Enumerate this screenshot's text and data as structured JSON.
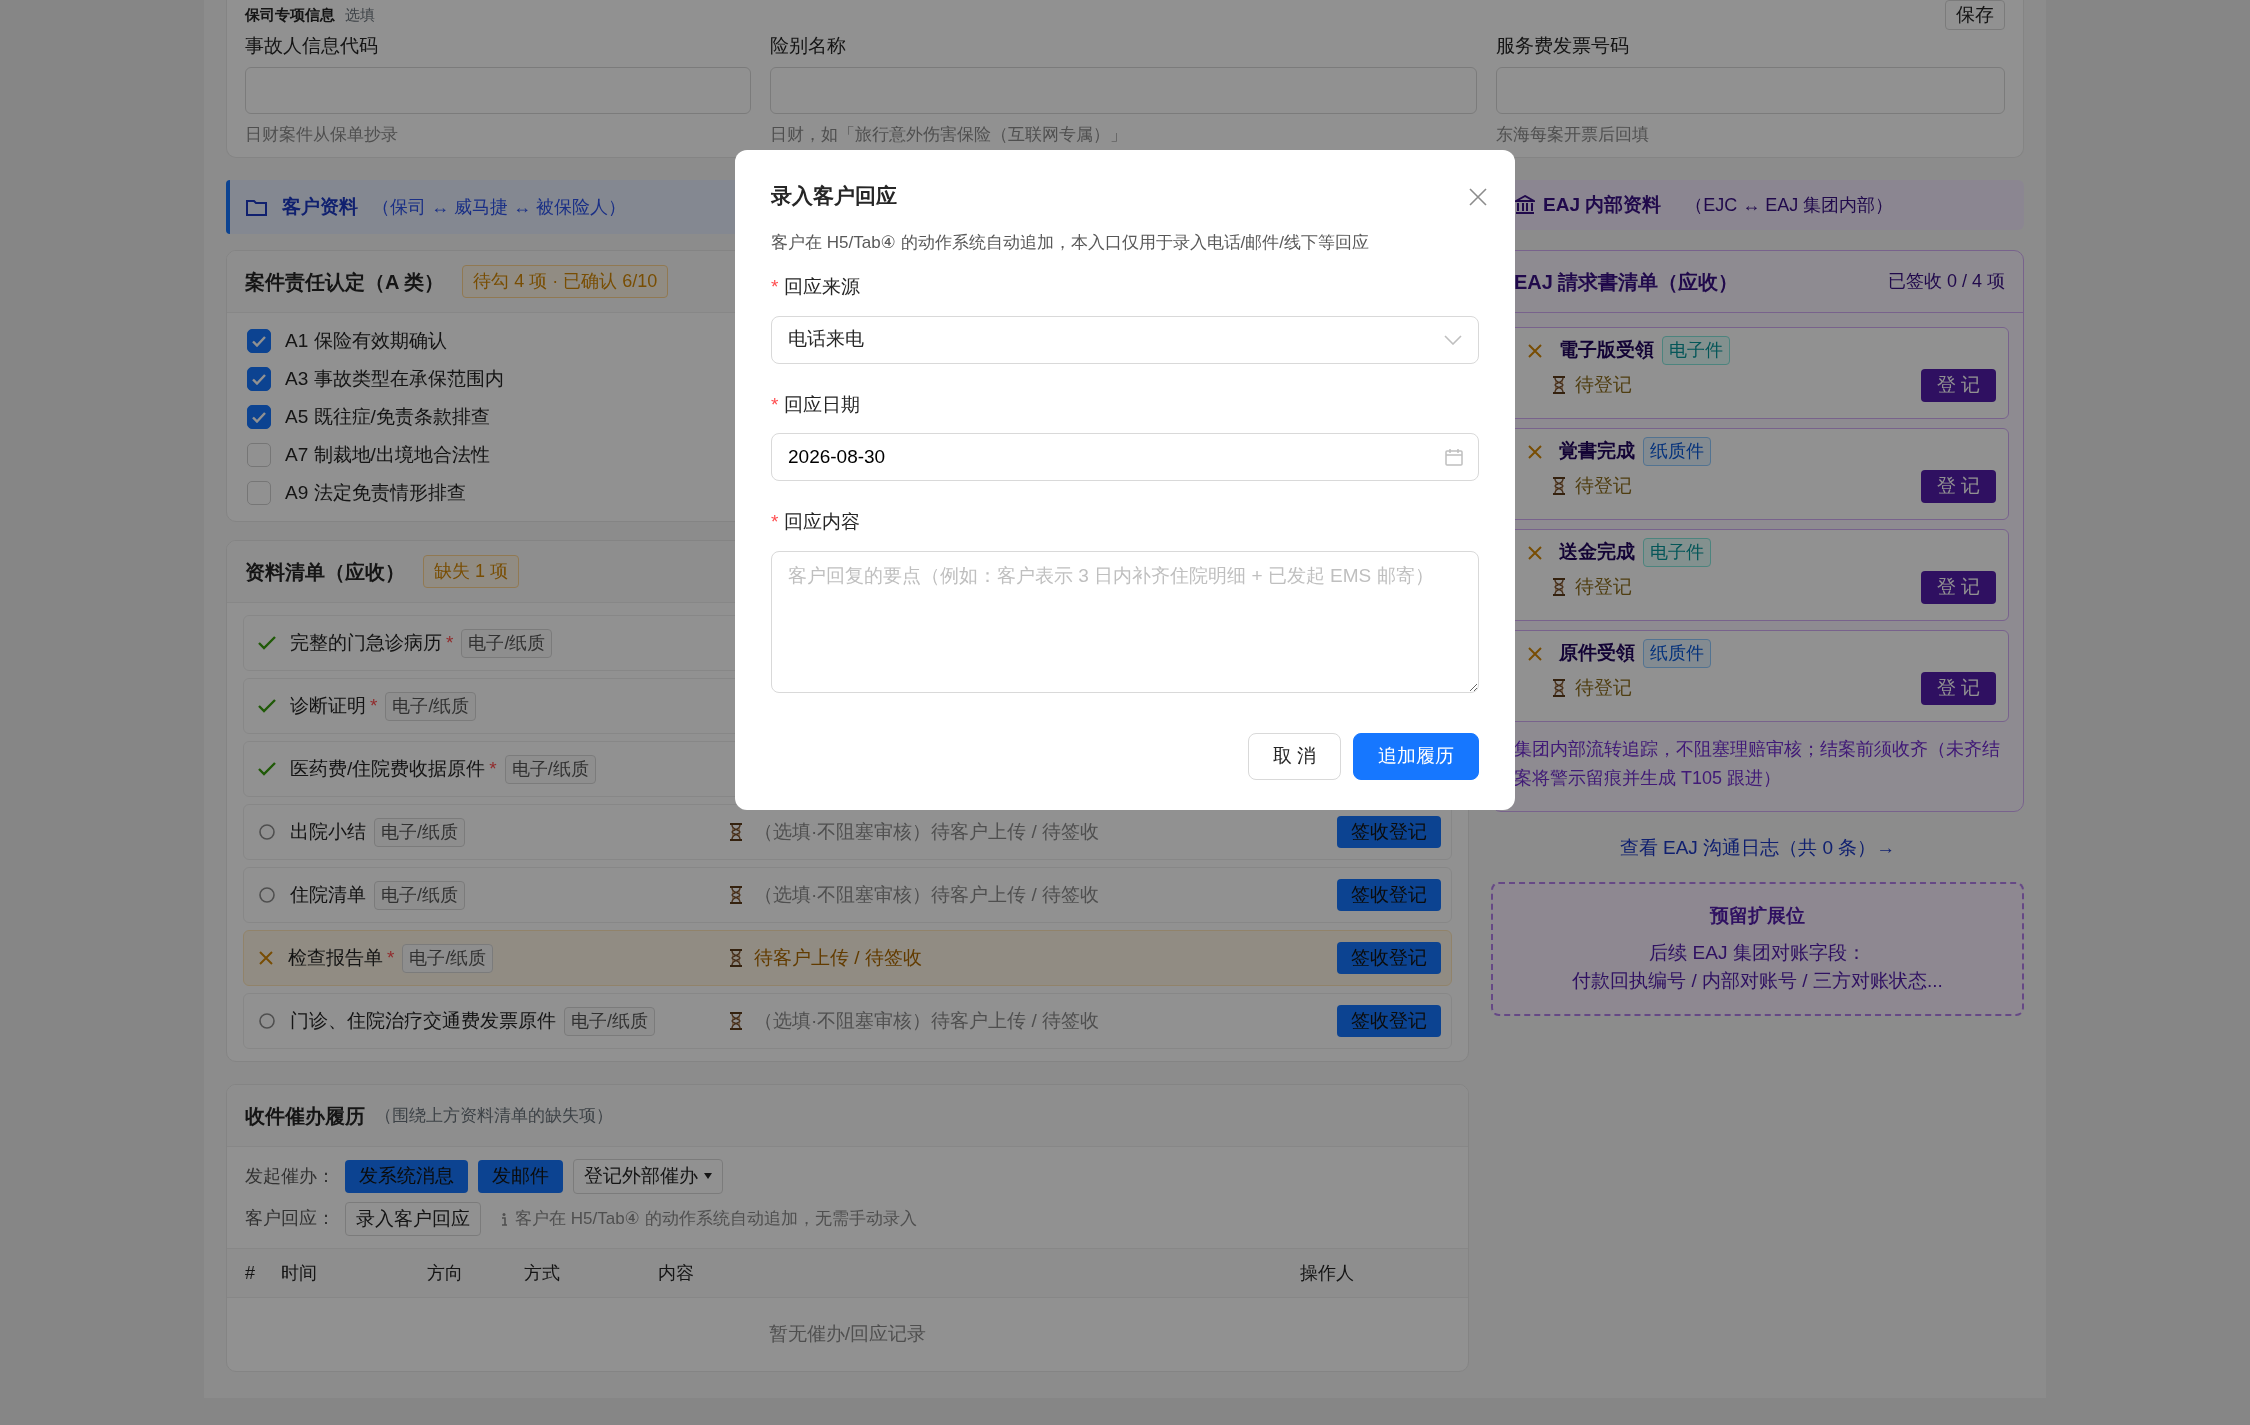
{
  "top_section": {
    "title": "保司专项信息",
    "note": "选填",
    "save_button": "保存",
    "fields": [
      {
        "label": "事故人信息代码",
        "hint": "日财案件从保单抄录"
      },
      {
        "label": "险别名称",
        "hint": "日财，如「旅行意外伤害保险（互联网专属）」"
      },
      {
        "label": "服务费发票号码",
        "hint": "东海每案开票后回填"
      }
    ]
  },
  "customer_banner": {
    "title": "客户资料",
    "subtitle": "（保司 ↔ 威马捷 ↔ 被保险人）"
  },
  "liability_card": {
    "title": "案件责任认定（A 类）",
    "badge": "待勾 4 项 · 已确认 6/10",
    "items": [
      {
        "label": "A1 保险有效期确认",
        "checked": true
      },
      {
        "label": "A3 事故类型在承保范围内",
        "checked": true
      },
      {
        "label": "A5 既往症/免责条款排查",
        "checked": true
      },
      {
        "label": "A7 制裁地/出境地合法性",
        "checked": false
      },
      {
        "label": "A9 法定免责情形排查",
        "checked": false
      }
    ]
  },
  "materials_card": {
    "title": "资料清单（应收）",
    "badge": "缺失 1 项",
    "rows": [
      {
        "kind": "received",
        "name": "完整的门急诊病历",
        "required_mark": "*",
        "tag": "电子/纸质"
      },
      {
        "kind": "received",
        "name": "诊断证明",
        "required_mark": "*",
        "tag": "电子/纸质"
      },
      {
        "kind": "received",
        "name": "医药费/住院费收据原件",
        "required_mark": "*",
        "tag": "电子/纸质"
      },
      {
        "kind": "optional",
        "name": "出院小结",
        "tag": "电子/纸质",
        "status": "（选填·不阻塞审核）待客户上传 / 待签收",
        "button": "签收登记"
      },
      {
        "kind": "optional",
        "name": "住院清单",
        "tag": "电子/纸质",
        "status": "（选填·不阻塞审核）待客户上传 / 待签收",
        "button": "签收登记"
      },
      {
        "kind": "missing",
        "name": "检查报告单",
        "required_mark": "*",
        "tag": "电子/纸质",
        "status": "待客户上传 / 待签收",
        "button": "签收登记"
      },
      {
        "kind": "optional",
        "name": "门诊、住院治疗交通费发票原件",
        "tag": "电子/纸质",
        "status": "（选填·不阻塞审核）待客户上传 / 待签收",
        "button": "签收登记"
      }
    ]
  },
  "history_card": {
    "title": "收件催办履历",
    "subtitle": "（围绕上方资料清单的缺失项）",
    "initiate_label": "发起催办：",
    "initiate_buttons": [
      {
        "label": "发系统消息",
        "kind": "primary"
      },
      {
        "label": "发邮件",
        "kind": "primary"
      },
      {
        "label": "登记外部催办",
        "kind": "dropdown"
      }
    ],
    "response_label": "客户回应：",
    "response_button": "录入客户回应",
    "response_note": "客户在 H5/Tab④ 的动作系统自动追加，无需手动录入",
    "columns": [
      "#",
      "时间",
      "方向",
      "方式",
      "内容",
      "操作人"
    ],
    "empty": "暂无催办/回应记录"
  },
  "eaj_banner": {
    "title": "EAJ 内部资料",
    "subtitle": "（EJC ↔ EAJ 集团内部）"
  },
  "eaj_card": {
    "title": "EAJ 請求書清单（应收）",
    "count": "已签收 0 / 4 项",
    "items": [
      {
        "name": "電子版受領",
        "tag": "电子件",
        "kind": "electronic",
        "received": false,
        "status": "待登记",
        "button": "登 记"
      },
      {
        "name": "覚書完成",
        "tag": "纸质件",
        "kind": "paper",
        "received": false,
        "status": "待登记",
        "button": "登 记"
      },
      {
        "name": "送金完成",
        "tag": "电子件",
        "kind": "electronic",
        "received": false,
        "status": "待登记",
        "button": "登 记"
      },
      {
        "name": "原件受領",
        "tag": "纸质件",
        "kind": "paper",
        "received": false,
        "status": "待登记",
        "button": "登 记"
      }
    ],
    "note": "集团内部流转追踪，不阻塞理赔审核；结案前须收齐（未齐结案将警示留痕并生成 T105 跟进）"
  },
  "eaj_log_link": "查看 EAJ 沟通日志（共 0 条）→",
  "reserved": {
    "title": "预留扩展位",
    "lines": [
      "后续 EAJ 集团对账字段：",
      "付款回执编号 / 内部对账号 / 三方对账状态..."
    ]
  },
  "modal": {
    "title": "录入客户回应",
    "description": "客户在 H5/Tab④ 的动作系统自动追加，本入口仅用于录入电话/邮件/线下等回应",
    "fields": [
      {
        "kind": "select",
        "label": "回应来源",
        "required_mark": "*",
        "value": "电话来电"
      },
      {
        "kind": "date",
        "label": "回应日期",
        "required_mark": "*",
        "value": "2026-08-30"
      },
      {
        "kind": "textarea",
        "label": "回应内容",
        "required_mark": "*",
        "placeholder": "客户回复的要点（例如：客户表示 3 日内补齐住院明细 + 已发起 EMS 邮寄）"
      }
    ],
    "buttons": [
      {
        "label": "取 消",
        "kind": "default"
      },
      {
        "label": "追加履历",
        "kind": "primary"
      }
    ]
  }
}
